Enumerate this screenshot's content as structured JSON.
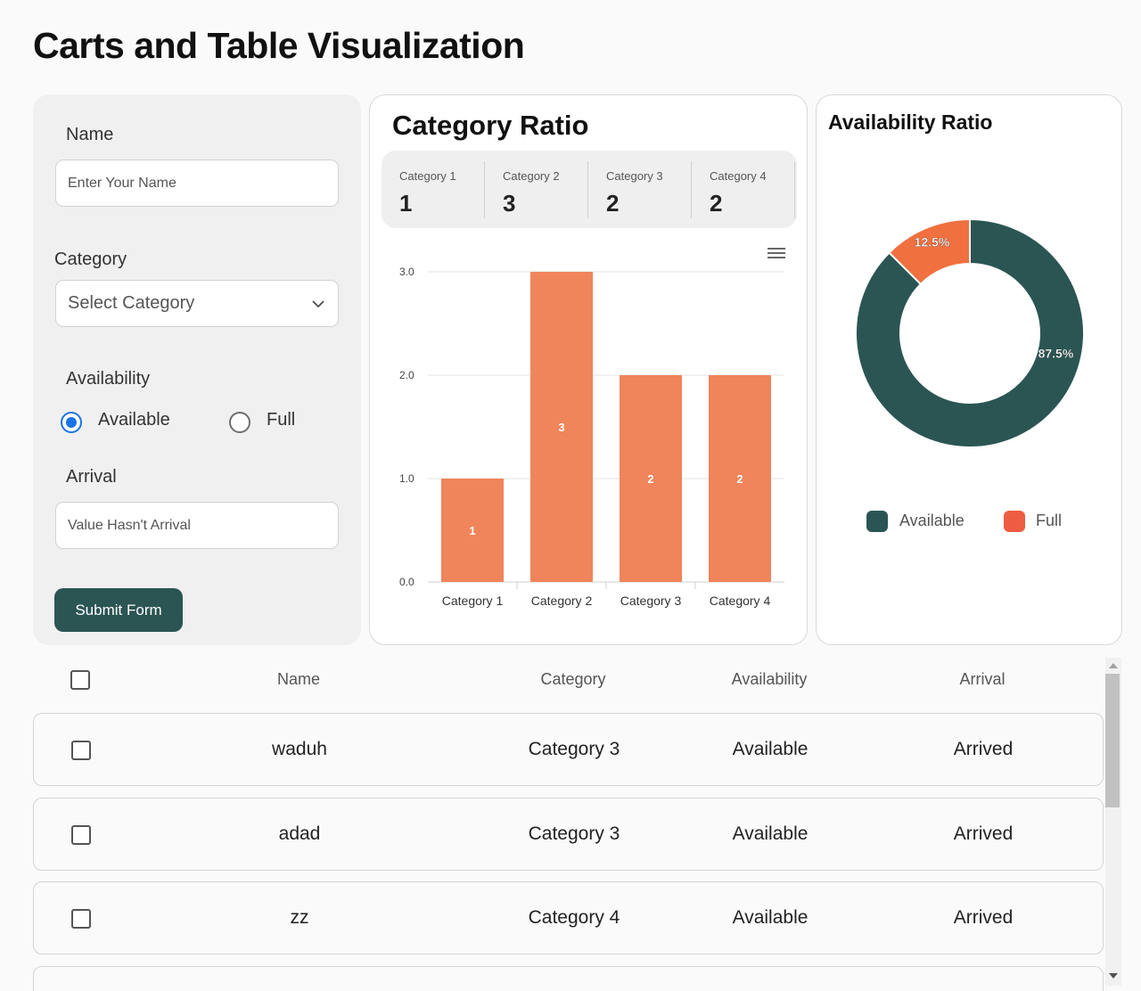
{
  "page": {
    "title": "Carts and Table Visualization"
  },
  "form": {
    "name_label": "Name",
    "name_placeholder": "Enter Your Name",
    "category_label": "Category",
    "category_value": "Select Category",
    "availability_label": "Availability",
    "radio_available": "Available",
    "radio_full": "Full",
    "arrival_label": "Arrival",
    "arrival_placeholder": "Value Hasn't Arrival",
    "submit_label": "Submit Form"
  },
  "category_card": {
    "title": "Category Ratio",
    "stats": [
      {
        "label": "Category 1",
        "value": "1"
      },
      {
        "label": "Category 2",
        "value": "3"
      },
      {
        "label": "Category 3",
        "value": "2"
      },
      {
        "label": "Category 4",
        "value": "2"
      }
    ]
  },
  "availability_card": {
    "title": "Availability Ratio",
    "legend": [
      {
        "label": "Available",
        "color": "#2b5553"
      },
      {
        "label": "Full",
        "color": "#ee5d41"
      }
    ]
  },
  "chart_data": [
    {
      "type": "bar",
      "categories": [
        "Category 1",
        "Category 2",
        "Category 3",
        "Category 4"
      ],
      "values": [
        1,
        3,
        2,
        2
      ],
      "data_labels": [
        "1",
        "3",
        "2",
        "2"
      ],
      "y_ticks": [
        "0.0",
        "1.0",
        "2.0",
        "3.0"
      ],
      "ylim": [
        0,
        3
      ],
      "color": "#f0845a",
      "grid": true
    },
    {
      "type": "pie",
      "donut": true,
      "categories": [
        "Available",
        "Full"
      ],
      "values": [
        87.5,
        12.5
      ],
      "data_labels": [
        "87.5%",
        "12.5%"
      ],
      "colors": [
        "#2b5553",
        "#f0703f"
      ],
      "legend": "bottom"
    }
  ],
  "table": {
    "headers": {
      "name": "Name",
      "category": "Category",
      "availability": "Availability",
      "arrival": "Arrival"
    },
    "rows": [
      {
        "name": "waduh",
        "category": "Category 3",
        "availability": "Available",
        "arrival": "Arrived"
      },
      {
        "name": "adad",
        "category": "Category 3",
        "availability": "Available",
        "arrival": "Arrived"
      },
      {
        "name": "zz",
        "category": "Category 4",
        "availability": "Available",
        "arrival": "Arrived"
      }
    ]
  }
}
